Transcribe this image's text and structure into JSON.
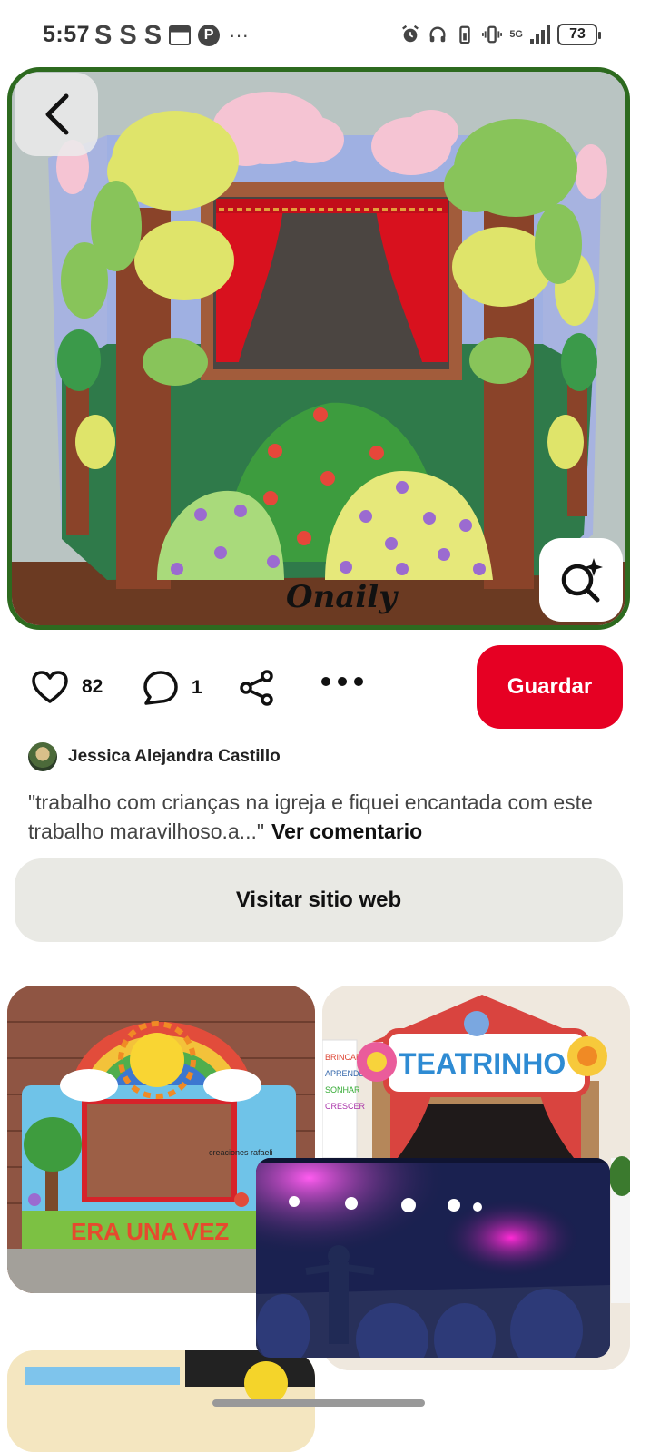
{
  "status_bar": {
    "time": "5:57",
    "s_icons": [
      "S",
      "S",
      "S"
    ],
    "overflow": "···",
    "network": "5G",
    "battery": "73"
  },
  "hero": {
    "watermark": "Onaily",
    "back_icon": "chevron-left-icon",
    "lens_icon": "visual-search-icon"
  },
  "actions": {
    "likes": "82",
    "comments": "1",
    "save_label": "Guardar",
    "accent": "#e60023"
  },
  "comment": {
    "author": "Jessica Alejandra Castillo",
    "text": "\"trabalho com crianças na igreja e fiquei encantada com este trabalho maravilhoso.a...\"",
    "more_label": "Ver comentario"
  },
  "visit_label": "Visitar sitio web",
  "grid": {
    "card1_text": "ERA UNA VEZ",
    "card1_credit": "creaciones rafaeli",
    "card2_title": "TEATRINHO",
    "card2_sign": [
      "BRINCAR",
      "APRENDER",
      "SONHAR",
      "CRESCER"
    ]
  }
}
